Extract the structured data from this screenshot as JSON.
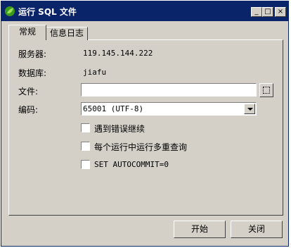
{
  "window": {
    "title": "运行 SQL 文件",
    "controls": {
      "minimize": "_",
      "maximize": "□",
      "close": "×"
    }
  },
  "tabs": [
    {
      "label": "常规",
      "active": true
    },
    {
      "label": "信息日志",
      "active": false
    }
  ],
  "form": {
    "server_label": "服务器:",
    "server_value": "119.145.144.222",
    "database_label": "数据库:",
    "database_value": "jiafu",
    "file_label": "文件:",
    "file_value": "",
    "encoding_label": "编码:",
    "encoding_value": "65001 (UTF-8)"
  },
  "options": [
    {
      "label": "遇到错误继续",
      "checked": false
    },
    {
      "label": "每个运行中运行多重查询",
      "checked": false
    },
    {
      "label": "SET AUTOCOMMIT=0",
      "checked": false
    }
  ],
  "buttons": {
    "start": "开始",
    "close": "关闭"
  },
  "colors": {
    "titlebar": "#0a246a",
    "face": "#d4d0c8"
  },
  "icons": {
    "app": "green-leaf-icon",
    "browse": "browse-icon",
    "dropdown": "chevron-down-icon"
  }
}
